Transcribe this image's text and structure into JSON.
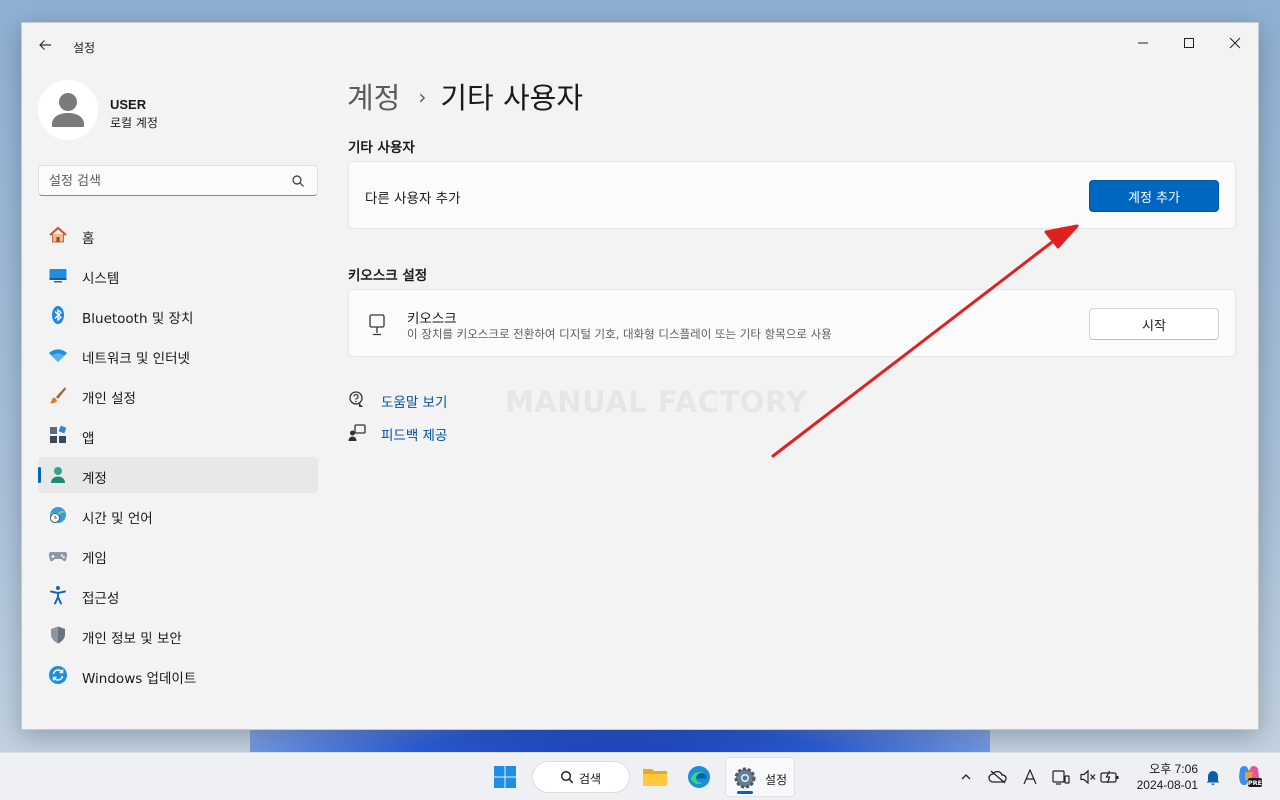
{
  "window": {
    "title": "설정"
  },
  "profile": {
    "name": "USER",
    "account_type": "로컬 계정"
  },
  "search": {
    "placeholder": "설정 검색"
  },
  "nav": {
    "items": [
      {
        "label": "홈",
        "icon": "home-icon"
      },
      {
        "label": "시스템",
        "icon": "system-icon"
      },
      {
        "label": "Bluetooth 및 장치",
        "icon": "bluetooth-icon"
      },
      {
        "label": "네트워크 및 인터넷",
        "icon": "wifi-icon"
      },
      {
        "label": "개인 설정",
        "icon": "brush-icon"
      },
      {
        "label": "앱",
        "icon": "apps-icon"
      },
      {
        "label": "계정",
        "icon": "account-icon",
        "active": true
      },
      {
        "label": "시간 및 언어",
        "icon": "time-language-icon"
      },
      {
        "label": "게임",
        "icon": "gamepad-icon"
      },
      {
        "label": "접근성",
        "icon": "accessibility-icon"
      },
      {
        "label": "개인 정보 및 보안",
        "icon": "shield-icon"
      },
      {
        "label": "Windows 업데이트",
        "icon": "update-icon"
      }
    ]
  },
  "breadcrumb": {
    "parent": "계정",
    "separator": "›",
    "current": "기타 사용자"
  },
  "other_users": {
    "section_title": "기타 사용자",
    "row_label": "다른 사용자 추가",
    "button_label": "계정 추가"
  },
  "kiosk": {
    "section_title": "키오스크 설정",
    "title": "키오스크",
    "description": "이 장치를 키오스크로 전환하여 디지털 기호, 대화형 디스플레이 또는 기타 항목으로 사용",
    "button_label": "시작"
  },
  "links": {
    "help": "도움말 보기",
    "feedback": "피드백 제공"
  },
  "watermark": "MANUAL FACTORY",
  "taskbar": {
    "search_label": "검색",
    "settings_label": "설정",
    "clock_time": "오후 7:06",
    "clock_date": "2024-08-01",
    "copilot_badge": "PRE"
  },
  "colors": {
    "accent": "#0067c0",
    "arrow": "#e02020",
    "window_bg": "#f3f3f3"
  }
}
